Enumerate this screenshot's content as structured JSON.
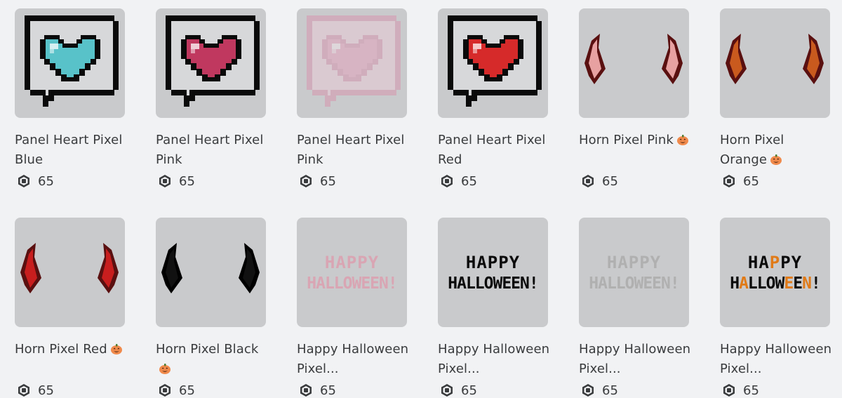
{
  "currency_icon": "robux-icon",
  "badge_icon": "pumpkin-icon",
  "items": [
    {
      "name": "Panel Heart Pixel Blue",
      "price": "65",
      "badge": false,
      "thumb": "heart",
      "color": "#58c2c9",
      "faded": false
    },
    {
      "name": "Panel Heart Pixel Pink",
      "price": "65",
      "badge": false,
      "thumb": "heart",
      "color": "#c0385f",
      "faded": false
    },
    {
      "name": "Panel Heart Pixel Pink",
      "price": "65",
      "badge": false,
      "thumb": "heart",
      "color": "#e89ab8",
      "faded": true
    },
    {
      "name": "Panel Heart Pixel Red",
      "price": "65",
      "badge": false,
      "thumb": "heart",
      "color": "#d62a2a",
      "faded": false
    },
    {
      "name": "Horn Pixel Pink",
      "price": "65",
      "badge": true,
      "thumb": "horns",
      "color": "#e7a1a1",
      "faded": false
    },
    {
      "name": "Horn Pixel Orange",
      "price": "65",
      "badge": true,
      "thumb": "horns",
      "color": "#c95a1e",
      "faded": false
    },
    {
      "name": "Horn Pixel Red",
      "price": "65",
      "badge": true,
      "thumb": "horns",
      "color": "#c81e1e",
      "faded": false
    },
    {
      "name": "Horn Pixel Black",
      "price": "65",
      "badge": true,
      "thumb": "horns",
      "color": "#111111",
      "faded": false
    },
    {
      "name": "Happy Halloween Pixel...",
      "price": "65",
      "badge": false,
      "thumb": "text",
      "color": "#d9a5b3",
      "faded": false
    },
    {
      "name": "Happy Halloween Pixel...",
      "price": "65",
      "badge": false,
      "thumb": "text",
      "color": "#0a0a0a",
      "faded": false
    },
    {
      "name": "Happy Halloween Pixel...",
      "price": "65",
      "badge": false,
      "thumb": "text",
      "color": "#b0b0b0",
      "faded": false
    },
    {
      "name": "Happy Halloween Pixel...",
      "price": "65",
      "badge": false,
      "thumb": "text-mixed",
      "color": "#0a0a0a",
      "accent": "#e07a17",
      "faded": false
    }
  ],
  "thumb_text_line1": "HAPPY",
  "thumb_text_line2": "HALLOWEEN!"
}
